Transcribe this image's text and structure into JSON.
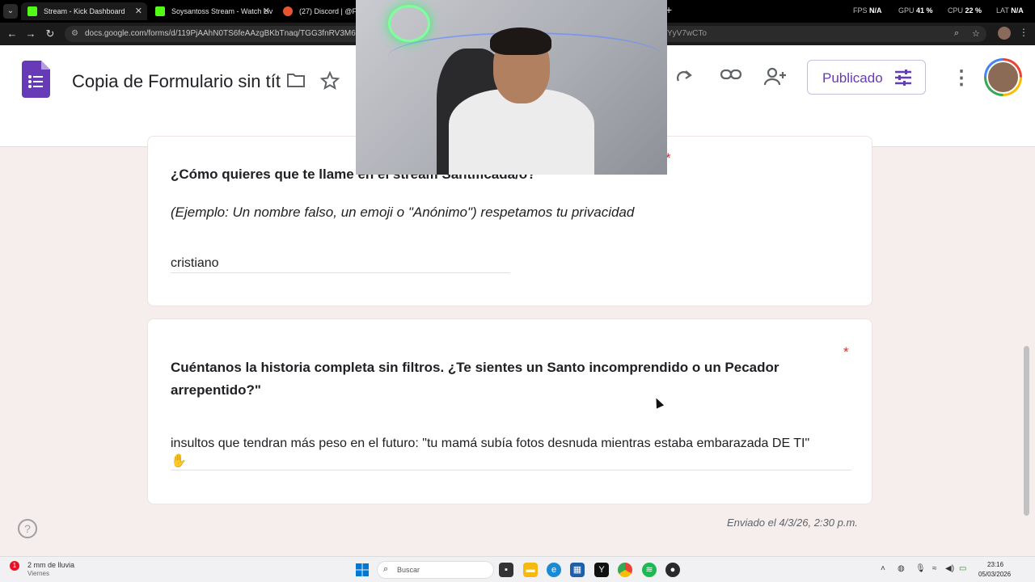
{
  "browser": {
    "tabs": [
      {
        "label": "Stream - Kick Dashboard",
        "favicon_color": "#53fc18"
      },
      {
        "label": "Soysantoss Stream - Watch Liv",
        "favicon_color": "#53fc18"
      },
      {
        "label": "(27) Discord | @Foog",
        "favicon_color": "#e8542f"
      }
    ],
    "perf": {
      "fps_label": "FPS",
      "fps": "N/A",
      "gpu_label": "GPU",
      "gpu": "41 %",
      "cpu_label": "CPU",
      "cpu": "22 %",
      "lat_label": "LAT",
      "lat": "N/A"
    },
    "url": "docs.google.com/forms/d/119PjAAhN0TS6feAAzgBKbTnaq/TGG3fnRV3M6gjhKYg",
    "url_tail": "YyV7wCTo"
  },
  "forms": {
    "title": "Copia de Formulario sin título",
    "publish_label": "Publicado",
    "brand_color": "#673ab7"
  },
  "questions": [
    {
      "title": "¿Cómo quieres que te llame en el stream Santificada/o?",
      "description": "(Ejemplo: Un nombre falso, un emoji o \"Anónimo\") respetamos tu privacidad",
      "answer": "cristiano",
      "required": "*"
    },
    {
      "title": "Cuéntanos la historia completa sin filtros. ¿Te sientes un Santo incomprendido o un Pecador arrepentido?\"",
      "answer": "insultos que tendran más peso en el futuro: \"tu mamá subía fotos desnuda mientras estaba embarazada DE TI\"",
      "answer_emoji": "✋",
      "required": "*"
    }
  ],
  "footer": {
    "sent": "Enviado el 4/3/26, 2:30 p.m."
  },
  "taskbar": {
    "weather_badge": "1",
    "weather_line1": "2 mm de lluvia",
    "weather_line2": "Viernes",
    "search_label": "Buscar",
    "time": "23:16",
    "date": "05/03/2026"
  }
}
